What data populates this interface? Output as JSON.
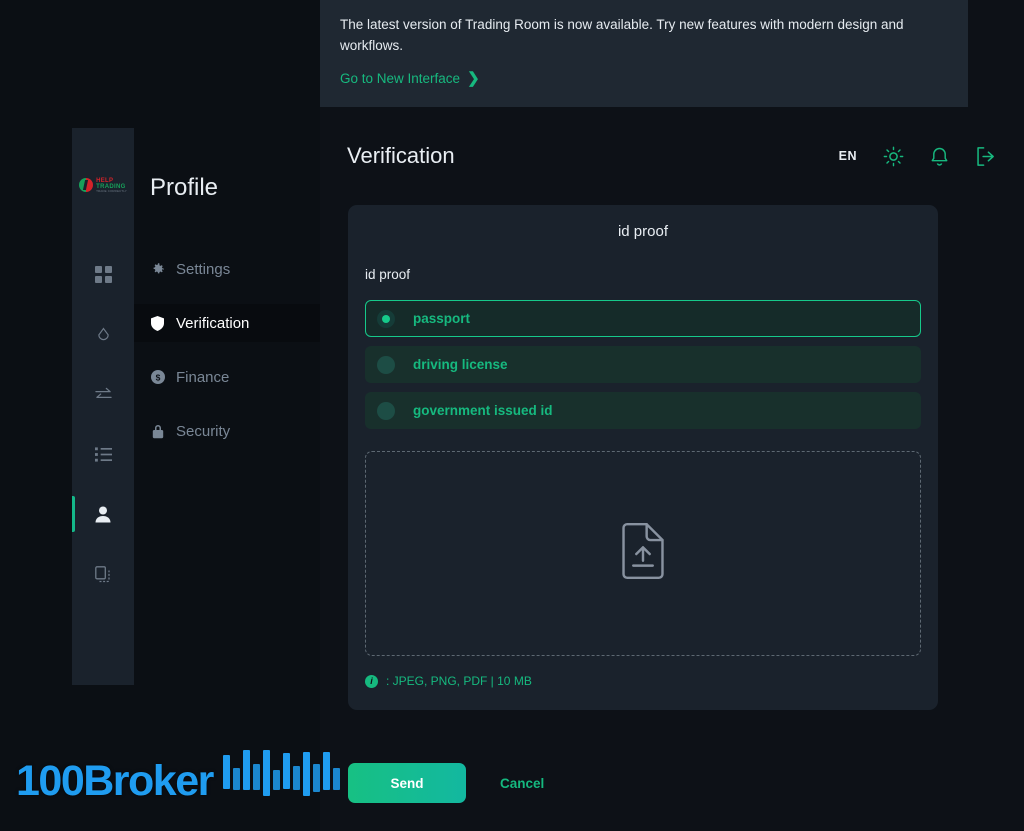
{
  "brand": {
    "logo_line1": "HELP",
    "logo_line2": "TRADING",
    "logo_line3": "TRADE CORRECTLY"
  },
  "icon_rail": {
    "items": [
      {
        "name": "dashboard",
        "icon": "grid-icon",
        "active": false
      },
      {
        "name": "alerts",
        "icon": "bell-diamond-icon",
        "active": false
      },
      {
        "name": "transfers",
        "icon": "exchange-arrows-icon",
        "active": false
      },
      {
        "name": "orders",
        "icon": "list-icon",
        "active": false
      },
      {
        "name": "profile",
        "icon": "user-icon",
        "active": true
      },
      {
        "name": "documents",
        "icon": "copy-icon",
        "active": false
      }
    ]
  },
  "sidebar": {
    "title": "Profile",
    "items": [
      {
        "label": "Settings",
        "icon": "gear-icon",
        "active": false
      },
      {
        "label": "Verification",
        "icon": "shield-icon",
        "active": true
      },
      {
        "label": "Finance",
        "icon": "dollar-circle-icon",
        "active": false
      },
      {
        "label": "Security",
        "icon": "lock-icon",
        "active": false
      }
    ]
  },
  "banner": {
    "text": "The latest version of Trading Room is now available. Try new features with modern design and workflows.",
    "link_label": "Go to New Interface",
    "chevron": "❯"
  },
  "header": {
    "title": "Verification",
    "language": "EN",
    "icons": [
      "sun-icon",
      "bell-icon",
      "logout-icon"
    ]
  },
  "card": {
    "title": "id proof",
    "field_label": "id proof",
    "options": [
      {
        "label": "passport",
        "selected": true
      },
      {
        "label": "driving license",
        "selected": false
      },
      {
        "label": "government issued id",
        "selected": false
      }
    ],
    "dropzone_icon": "file-upload-icon",
    "file_hint": ": JPEG, PNG, PDF | 10 MB",
    "info_icon": "info-icon"
  },
  "footer": {
    "send_label": "Send",
    "cancel_label": "Cancel"
  },
  "watermark": {
    "text": "100Broker",
    "color": "#1f9cf0"
  },
  "colors": {
    "page_bg": "#0d1117",
    "rail_bg": "#1a222c",
    "card_bg": "#1a222c",
    "banner_bg": "#1f2832",
    "accent_green": "#16b97f",
    "accent_bright": "#16c98a",
    "logo_red": "#d2232a",
    "logo_green": "#17a05a"
  }
}
